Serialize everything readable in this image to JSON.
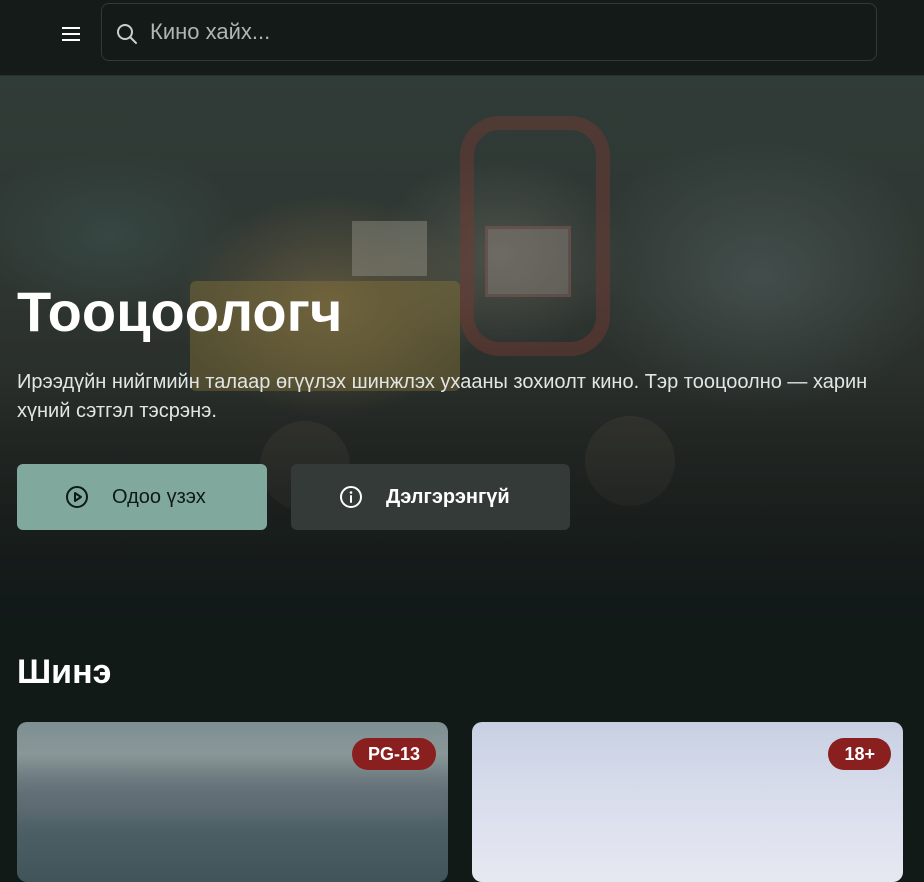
{
  "header": {
    "search": {
      "placeholder": "Кино хайх..."
    }
  },
  "hero": {
    "title": "Тооцоологч",
    "description": "Ирээдүйн нийгмийн талаар өгүүлэх шинжлэх ухааны зохиолт кино. Тэр тооцоолно — харин хүний сэтгэл тэсрэнэ.",
    "watch_label": "Одоо үзэх",
    "details_label": "Дэлгэрэнгүй"
  },
  "section": {
    "title": "Шинэ",
    "cards": [
      {
        "rating": "PG-13"
      },
      {
        "rating": "18+"
      }
    ]
  },
  "colors": {
    "background": "#121a18",
    "primary_button": "#80a89c",
    "secondary_button": "#333a38",
    "rating_badge": "#8a1f1f"
  },
  "icons": [
    "menu-icon",
    "search-icon",
    "play-circle-icon",
    "info-circle-icon"
  ]
}
